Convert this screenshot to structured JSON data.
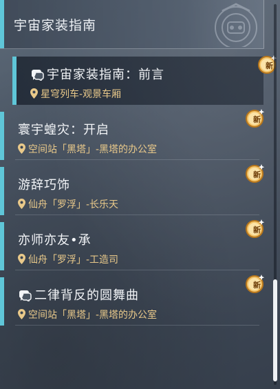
{
  "header": {
    "title": "宇宙家装指南"
  },
  "entries": [
    {
      "title": "宇宙家装指南：前言",
      "location": "星穹列车-观景车厢",
      "has_chat_icon": true,
      "badge": "新",
      "selected": true
    },
    {
      "title": "寰宇蝗灾：开启",
      "location": "空间站「黑塔」-黑塔的办公室",
      "has_chat_icon": false,
      "badge": "新",
      "selected": false
    },
    {
      "title": "游辞巧饰",
      "location": "仙舟「罗浮」-长乐天",
      "has_chat_icon": false,
      "badge": "新",
      "selected": false
    },
    {
      "title": "亦师亦友•承",
      "location": "仙舟「罗浮」-工造司",
      "has_chat_icon": false,
      "badge": "新",
      "selected": false
    },
    {
      "title": "二律背反的圆舞曲",
      "location": "空间站「黑塔」-黑塔的办公室",
      "has_chat_icon": true,
      "badge": "新",
      "selected": false
    }
  ],
  "colors": {
    "accent": "#5fc6d8",
    "location_text": "#e9c98a",
    "badge_gold": "#e7a93a"
  },
  "icons": {
    "chat": "chat-bubble-icon",
    "location": "map-pin-icon",
    "badge": "new-badge-icon"
  }
}
